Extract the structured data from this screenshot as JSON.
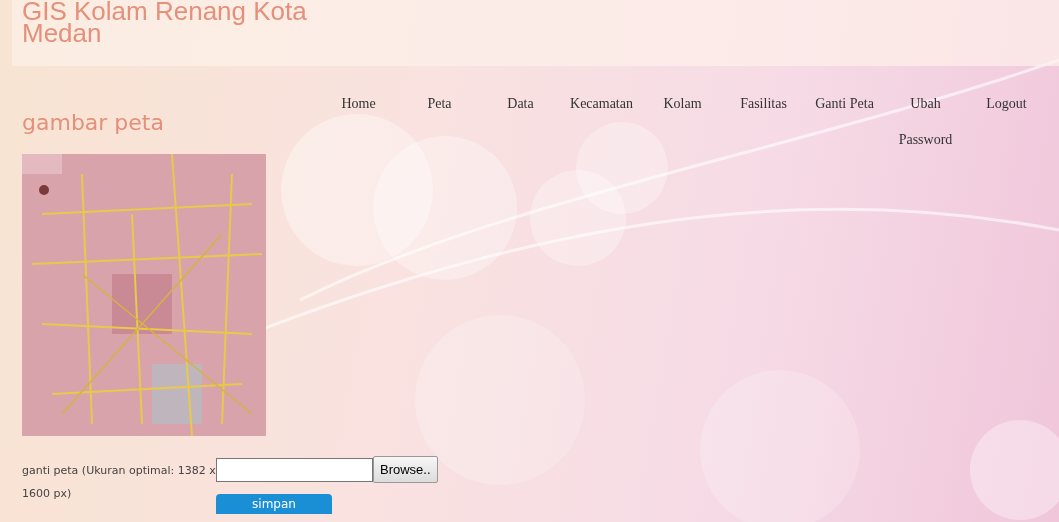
{
  "site_title": "GIS Kolam Renang Kota Medan",
  "nav": [
    {
      "label": "Home"
    },
    {
      "label": "Peta"
    },
    {
      "label": "Data"
    },
    {
      "label": "Kecamatan"
    },
    {
      "label": "Kolam"
    },
    {
      "label": "Fasilitas"
    },
    {
      "label": "Ganti Peta"
    },
    {
      "label": "Ubah Password"
    },
    {
      "label": "Logout"
    }
  ],
  "section_title": "gambar peta",
  "form": {
    "label": "ganti peta (Ukuran optimal: 1382 x 1600 px)",
    "browse_button": "Browse..",
    "submit_button": "simpan"
  }
}
